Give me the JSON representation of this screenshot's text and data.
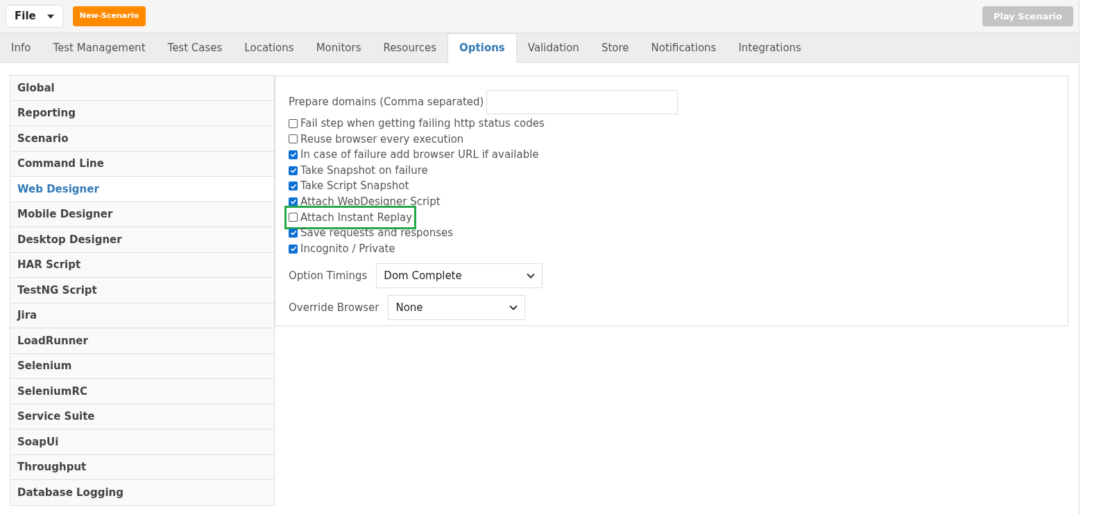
{
  "toolbar": {
    "file_menu": "File",
    "new_button": "New-Scenario",
    "play_button": {
      "label": "Play Scenario",
      "disabled": true
    }
  },
  "tabs": [
    {
      "label": "Info",
      "selected": false
    },
    {
      "label": "Test Management",
      "selected": false
    },
    {
      "label": "Test Cases",
      "selected": false
    },
    {
      "label": "Locations",
      "selected": false
    },
    {
      "label": "Monitors",
      "selected": false
    },
    {
      "label": "Resources",
      "selected": false
    },
    {
      "label": "Options",
      "selected": true
    },
    {
      "label": "Validation",
      "selected": false
    },
    {
      "label": "Store",
      "selected": false
    },
    {
      "label": "Notifications",
      "selected": false
    },
    {
      "label": "Integrations",
      "selected": false
    }
  ],
  "sidebar": {
    "items": [
      {
        "label": "Global",
        "selected": false
      },
      {
        "label": "Reporting",
        "selected": false
      },
      {
        "label": "Scenario",
        "selected": false
      },
      {
        "label": "Command Line",
        "selected": false
      },
      {
        "label": "Web Designer",
        "selected": true
      },
      {
        "label": "Mobile Designer",
        "selected": false
      },
      {
        "label": "Desktop Designer",
        "selected": false
      },
      {
        "label": "HAR Script",
        "selected": false
      },
      {
        "label": "TestNG Script",
        "selected": false
      },
      {
        "label": "Jira",
        "selected": false
      },
      {
        "label": "LoadRunner",
        "selected": false
      },
      {
        "label": "Selenium",
        "selected": false
      },
      {
        "label": "SeleniumRC",
        "selected": false
      },
      {
        "label": "Service Suite",
        "selected": false
      },
      {
        "label": "SoapUi",
        "selected": false
      },
      {
        "label": "Throughput",
        "selected": false
      },
      {
        "label": "Database Logging",
        "selected": false
      }
    ]
  },
  "options": {
    "prepare_domains": {
      "label": "Prepare domains (Comma separated)"
    },
    "checkboxes": [
      {
        "label": "Fail step when getting failing http status codes",
        "checked": false,
        "highlighted": false
      },
      {
        "label": "Reuse browser every execution",
        "checked": false,
        "highlighted": false
      },
      {
        "label": "In case of failure add browser URL if available",
        "checked": true,
        "highlighted": false
      },
      {
        "label": "Take Snapshot on failure",
        "checked": true,
        "highlighted": false
      },
      {
        "label": "Take Script Snapshot",
        "checked": true,
        "highlighted": false
      },
      {
        "label": "Attach WebDesigner Script",
        "checked": true,
        "highlighted": false
      },
      {
        "label": "Attach Instant Replay",
        "checked": false,
        "highlighted": true
      },
      {
        "label": "Save requests and responses",
        "checked": true,
        "highlighted": false
      },
      {
        "label": "Incognito / Private",
        "checked": true,
        "highlighted": false
      }
    ],
    "selects": [
      {
        "label": "Option Timings",
        "value": "Dom Complete"
      },
      {
        "label": "Override Browser",
        "value": "None"
      }
    ]
  }
}
